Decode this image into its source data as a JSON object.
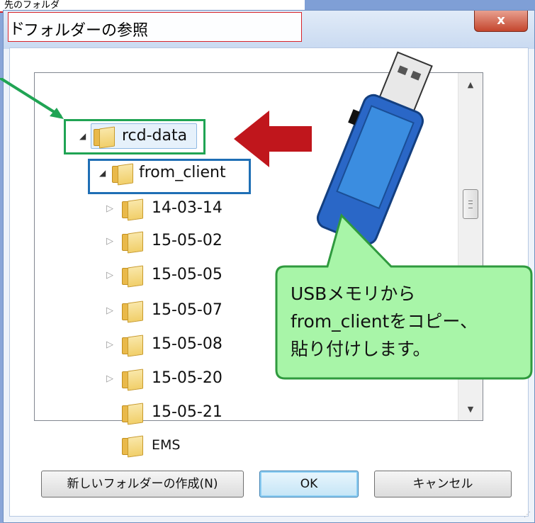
{
  "background_strip": {
    "text": "先のフォルダ"
  },
  "dialog": {
    "title_prefix": "ド",
    "title": "フォルダーの参照",
    "close_label": "x"
  },
  "tree": {
    "nodes": [
      {
        "label": "rcd-data",
        "expanded": true
      },
      {
        "label": "from_client",
        "expanded": true
      },
      {
        "label": "14-03-14",
        "expanded": false
      },
      {
        "label": "15-05-02",
        "expanded": false
      },
      {
        "label": "15-05-05",
        "expanded": false
      },
      {
        "label": "15-05-07",
        "expanded": false
      },
      {
        "label": "15-05-08",
        "expanded": false
      },
      {
        "label": "15-05-20",
        "expanded": false
      },
      {
        "label": "15-05-21",
        "expanded": null
      },
      {
        "label": "EMS",
        "expanded": null
      }
    ]
  },
  "callout": {
    "line1": "USBメモリから",
    "line2": "from_clientをコピー、",
    "line3": "貼り付けします。"
  },
  "buttons": {
    "new_folder": "新しいフォルダーの作成(N)",
    "ok": "OK",
    "cancel": "キャンセル"
  },
  "colors": {
    "green_highlight": "#20a454",
    "blue_highlight": "#1f6fb5",
    "red_arrow": "#c0161c",
    "callout_fill": "#a8f5a8",
    "usb_blue": "#2a67c7"
  }
}
